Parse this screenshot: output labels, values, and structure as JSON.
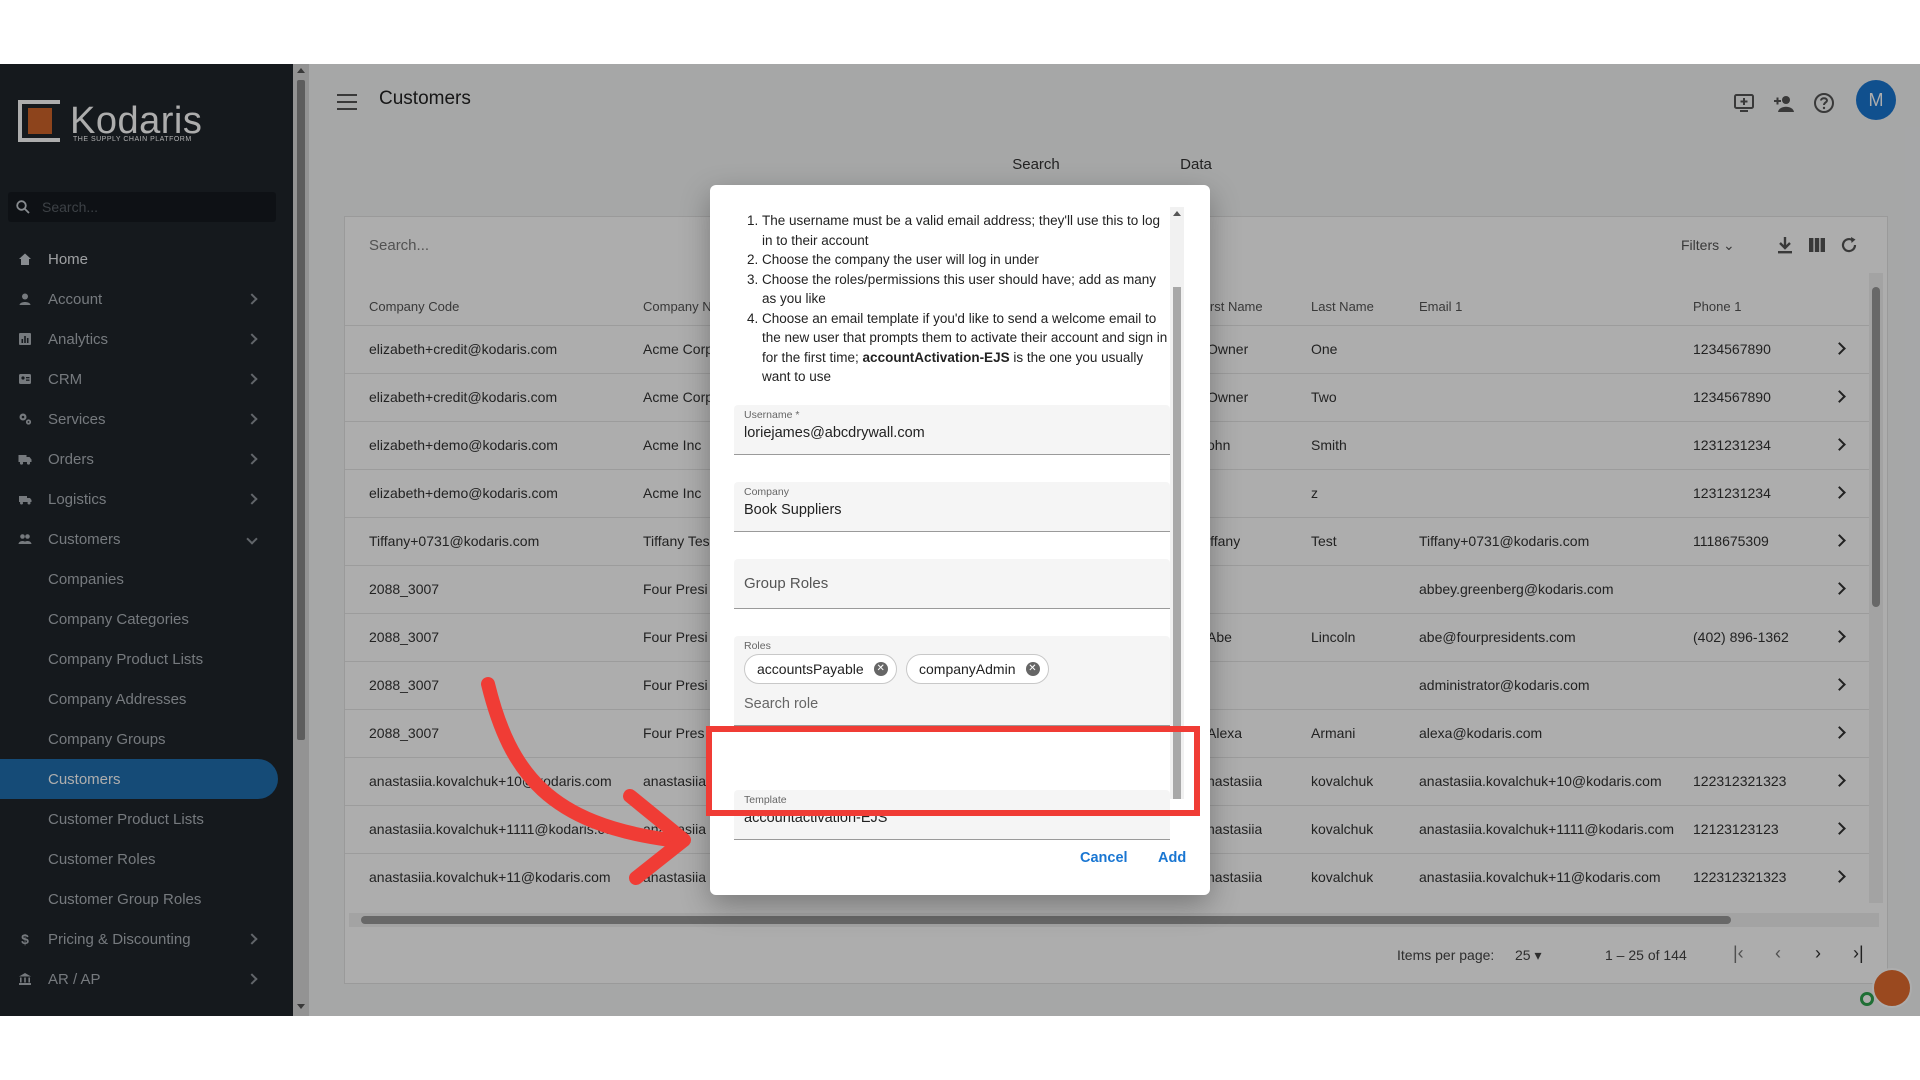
{
  "sidebar": {
    "brand": "Kodaris",
    "brand_tagline": "THE SUPPLY CHAIN PLATFORM",
    "search_placeholder": "Search...",
    "items": [
      {
        "label": "Home"
      },
      {
        "label": "Account"
      },
      {
        "label": "Analytics"
      },
      {
        "label": "CRM"
      },
      {
        "label": "Services"
      },
      {
        "label": "Orders"
      },
      {
        "label": "Logistics"
      },
      {
        "label": "Customers"
      }
    ],
    "customers_sub": [
      {
        "label": "Companies"
      },
      {
        "label": "Company Categories"
      },
      {
        "label": "Company Product Lists"
      },
      {
        "label": "Company Addresses"
      },
      {
        "label": "Company Groups"
      },
      {
        "label": "Customers"
      },
      {
        "label": "Customer Product Lists"
      },
      {
        "label": "Customer Roles"
      },
      {
        "label": "Customer Group Roles"
      }
    ],
    "bottom_items": [
      {
        "label": "Pricing & Discounting"
      },
      {
        "label": "AR / AP"
      }
    ]
  },
  "header": {
    "title": "Customers",
    "avatar_initial": "M"
  },
  "tabs": [
    {
      "label": "Search"
    },
    {
      "label": "Data"
    }
  ],
  "table": {
    "search_placeholder": "Search...",
    "filters_label": "Filters",
    "columns": [
      "Company Code",
      "Company Na",
      "irst Name",
      "Last Name",
      "Email 1",
      "Phone 1"
    ],
    "rows": [
      [
        "elizabeth+credit@kodaris.com",
        "Acme Corp",
        "Owner",
        "One",
        "",
        "1234567890"
      ],
      [
        "elizabeth+credit@kodaris.com",
        "Acme Corp",
        "Owner",
        "Two",
        "",
        "1234567890"
      ],
      [
        "elizabeth+demo@kodaris.com",
        "Acme Inc",
        "ohn",
        "Smith",
        "",
        "1231231234"
      ],
      [
        "elizabeth+demo@kodaris.com",
        "Acme Inc",
        "",
        "z",
        "",
        "1231231234"
      ],
      [
        "Tiffany+0731@kodaris.com",
        "Tiffany Tes",
        "iffany",
        "Test",
        "Tiffany+0731@kodaris.com",
        "1118675309"
      ],
      [
        "2088_3007",
        "Four Presi",
        "",
        "",
        "abbey.greenberg@kodaris.com",
        ""
      ],
      [
        "2088_3007",
        "Four Presi",
        "Abe",
        "Lincoln",
        "abe@fourpresidents.com",
        "(402) 896-1362"
      ],
      [
        "2088_3007",
        "Four Presi",
        "",
        "",
        "administrator@kodaris.com",
        ""
      ],
      [
        "2088_3007",
        "Four Pres",
        "Alexa",
        "Armani",
        "alexa@kodaris.com",
        ""
      ],
      [
        "anastasiia.kovalchuk+10@kodaris.com",
        "anastasiia",
        "nastasiia",
        "kovalchuk",
        "anastasiia.kovalchuk+10@kodaris.com",
        "122312321323"
      ],
      [
        "anastasiia.kovalchuk+1111@kodaris.com",
        "anastasiia",
        "nastasiia",
        "kovalchuk",
        "anastasiia.kovalchuk+1111@kodaris.com",
        "12123123123"
      ],
      [
        "anastasiia.kovalchuk+11@kodaris.com",
        "anastasiia",
        "nastasiia",
        "kovalchuk",
        "anastasiia.kovalchuk+11@kodaris.com",
        "122312321323"
      ]
    ],
    "items_per_page_label": "Items per page:",
    "items_per_page": "25",
    "range": "1 – 25 of 144"
  },
  "dialog": {
    "instructions": [
      "The username must be a valid email address; they'll use this to log in to their account",
      "Choose the company the user will log in under",
      "Choose the roles/permissions this user should have; add as many as you like",
      "Choose an email template if you'd like to send a welcome email to the new user that prompts them to activate their account and sign in for the first time;"
    ],
    "instr4_bold": "accountActivation-EJS",
    "instr4_tail": " is the one you usually want to use",
    "username_label": "Username *",
    "username_value": "loriejames@abcdrywall.com",
    "company_label": "Company",
    "company_value": "Book Suppliers",
    "group_roles_placeholder": "Group Roles",
    "roles_label": "Roles",
    "roles": [
      "accountsPayable",
      "companyAdmin"
    ],
    "roles_search_placeholder": "Search role",
    "template_label": "Template",
    "template_value": "accountactivation-EJS",
    "cancel_label": "Cancel",
    "add_label": "Add"
  },
  "colors": {
    "primary": "#1976d2",
    "annotation": "#f03c35",
    "sidebar_bg": "#1f252c",
    "brand_orange": "#d0652a"
  }
}
